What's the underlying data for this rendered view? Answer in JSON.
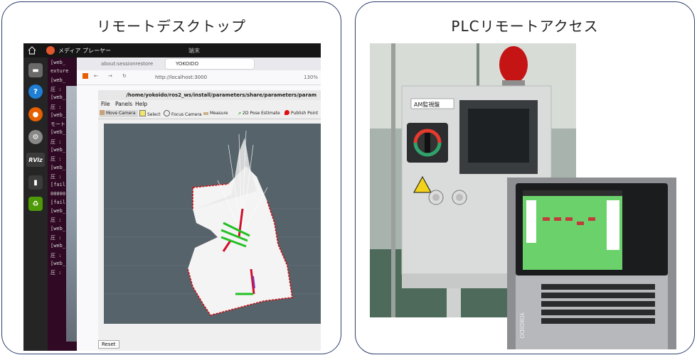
{
  "left": {
    "title": "リモートデスクトップ",
    "topbar": {
      "app_name": "メディア プレーヤー",
      "clock": "端末"
    },
    "terminal_lines": [
      "[web_",
      "exture",
      "[web_",
      "圧 :",
      "[web_",
      "圧 :",
      "[web_",
      "モート",
      "[web_",
      "圧 :",
      "[web_",
      "圧 :",
      "[web_",
      "圧 :",
      "[fail",
      "00000",
      "[fail",
      "[web_",
      "圧 :",
      "[web_",
      "圧 :",
      "[web_",
      "圧 :",
      "[web_",
      "圧 :"
    ],
    "browser": {
      "tab1": "about:sessionrestore",
      "tab2": "YOKOIDO",
      "url": "http://localhost:3000",
      "zoom": "130%"
    },
    "rviz": {
      "title": "/home/yokoido/ros2_ws/install/parameters/share/parameters/param",
      "menu": [
        "File",
        "Panels",
        "Help"
      ],
      "tools": [
        "Move Camera",
        "Select",
        "Focus Camera",
        "Measure",
        "2D Pose Estimate",
        "Publish Point"
      ],
      "reset": "Reset"
    },
    "dock_labels": {
      "rviz": "RViz"
    }
  },
  "right": {
    "title": "PLCリモートアクセス",
    "panel_label": "AM監視盤",
    "laptop_brand": "YOKOIDO"
  },
  "colors": {
    "border": "#2c3f6b",
    "map_bg": "#56636a",
    "occupied": "#c0181e",
    "pose_green": "#22c122",
    "arrow_red": "#d0102a"
  }
}
